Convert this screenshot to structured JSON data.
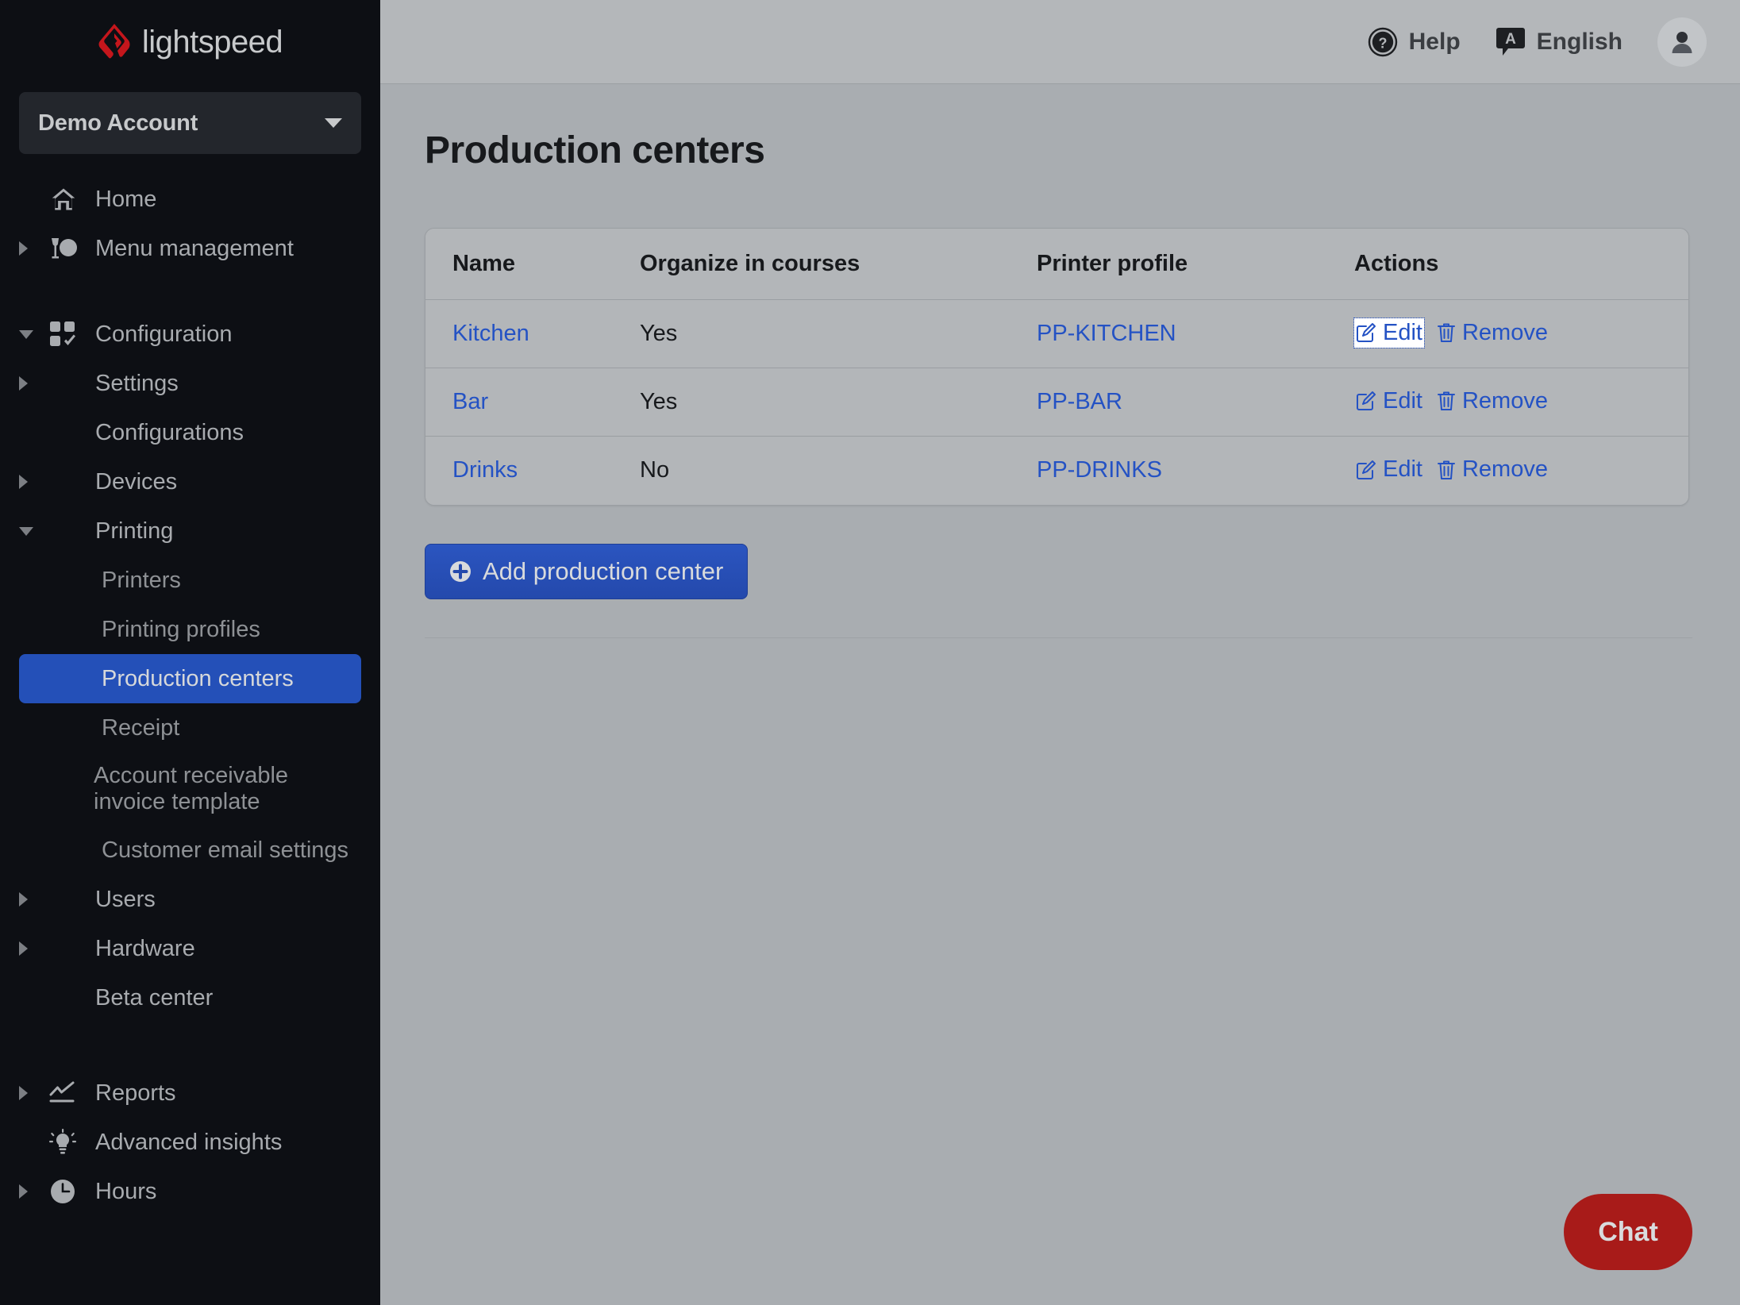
{
  "brand": {
    "name": "lightspeed",
    "logo_color": "#c4161c",
    "accent_blue": "#2450b8",
    "chat_red": "#a81b19"
  },
  "sidebar": {
    "account": {
      "label": "Demo Account",
      "caret": "chevron-down-icon"
    },
    "items": [
      {
        "label": "Home",
        "icon": "home-icon",
        "level": 0,
        "arrow": "none",
        "state": "normal"
      },
      {
        "label": "Menu management",
        "icon": "menu-management-icon",
        "level": 0,
        "arrow": "right",
        "state": "normal"
      },
      {
        "label": "Configuration",
        "icon": "configuration-icon",
        "level": 0,
        "arrow": "down",
        "state": "normal"
      },
      {
        "label": "Settings",
        "icon": "none",
        "level": 1,
        "arrow": "right",
        "state": "normal"
      },
      {
        "label": "Configurations",
        "icon": "none",
        "level": 1,
        "arrow": "none",
        "state": "normal"
      },
      {
        "label": "Devices",
        "icon": "none",
        "level": 1,
        "arrow": "right",
        "state": "normal"
      },
      {
        "label": "Printing",
        "icon": "none",
        "level": 1,
        "arrow": "down",
        "state": "normal"
      },
      {
        "label": "Printers",
        "icon": "none",
        "level": 2,
        "arrow": "none",
        "state": "dim"
      },
      {
        "label": "Printing profiles",
        "icon": "none",
        "level": 2,
        "arrow": "none",
        "state": "dim"
      },
      {
        "label": "Production centers",
        "icon": "none",
        "level": 2,
        "arrow": "none",
        "state": "selected"
      },
      {
        "label": "Receipt",
        "icon": "none",
        "level": 2,
        "arrow": "none",
        "state": "dim"
      },
      {
        "label": "Account receivable invoice template",
        "icon": "none",
        "level": 2,
        "arrow": "none",
        "state": "dim"
      },
      {
        "label": "Customer email settings",
        "icon": "none",
        "level": 2,
        "arrow": "none",
        "state": "dim"
      },
      {
        "label": "Users",
        "icon": "none",
        "level": 1,
        "arrow": "right",
        "state": "normal"
      },
      {
        "label": "Hardware",
        "icon": "none",
        "level": 1,
        "arrow": "right",
        "state": "normal"
      },
      {
        "label": "Beta center",
        "icon": "none",
        "level": 1,
        "arrow": "none",
        "state": "normal"
      },
      {
        "label": "Reports",
        "icon": "reports-icon",
        "level": 0,
        "arrow": "right",
        "state": "normal"
      },
      {
        "label": "Advanced insights",
        "icon": "lightbulb-icon",
        "level": 0,
        "arrow": "none",
        "state": "normal"
      },
      {
        "label": "Hours",
        "icon": "clock-icon",
        "level": 0,
        "arrow": "right",
        "state": "normal"
      }
    ]
  },
  "topbar": {
    "help_label": "Help",
    "help_icon": "question-circle-icon",
    "language_label": "English",
    "language_icon": "translate-icon",
    "avatar_icon": "user-avatar-icon"
  },
  "main": {
    "page_title": "Production centers",
    "table": {
      "columns": [
        "Name",
        "Organize in courses",
        "Printer profile",
        "Actions"
      ],
      "rows": [
        {
          "name": "Kitchen",
          "organize": "Yes",
          "printer_profile": "PP-KITCHEN",
          "edit_label": "Edit",
          "remove_label": "Remove",
          "edit_icon": "pencil-square-icon",
          "remove_icon": "trash-icon",
          "edit_focused": true
        },
        {
          "name": "Bar",
          "organize": "Yes",
          "printer_profile": "PP-BAR",
          "edit_label": "Edit",
          "remove_label": "Remove",
          "edit_icon": "pencil-square-icon",
          "remove_icon": "trash-icon",
          "edit_focused": false
        },
        {
          "name": "Drinks",
          "organize": "No",
          "printer_profile": "PP-DRINKS",
          "edit_label": "Edit",
          "remove_label": "Remove",
          "edit_icon": "pencil-square-icon",
          "remove_icon": "trash-icon",
          "edit_focused": false
        }
      ]
    },
    "add_button": {
      "label": "Add production center",
      "icon": "plus-circle-icon"
    }
  },
  "chat": {
    "label": "Chat"
  }
}
